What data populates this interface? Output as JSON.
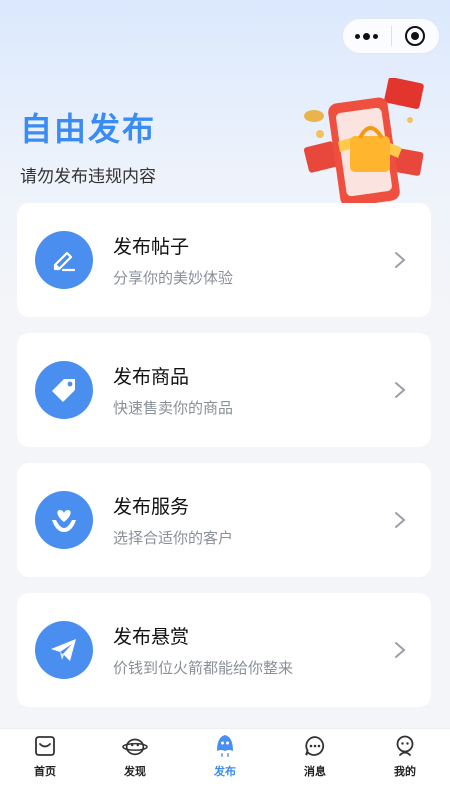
{
  "hero": {
    "title": "自由发布",
    "subtitle": "请勿发布违规内容"
  },
  "cards": [
    {
      "title": "发布帖子",
      "desc": "分享你的美妙体验",
      "icon": "pencil-icon"
    },
    {
      "title": "发布商品",
      "desc": "快速售卖你的商品",
      "icon": "tag-icon"
    },
    {
      "title": "发布服务",
      "desc": "选择合适你的客户",
      "icon": "heart-hand-icon"
    },
    {
      "title": "发布悬赏",
      "desc": "价钱到位火箭都能给你整来",
      "icon": "paper-plane-icon"
    }
  ],
  "tabs": [
    {
      "label": "首页",
      "icon": "home-icon"
    },
    {
      "label": "发现",
      "icon": "discover-icon"
    },
    {
      "label": "发布",
      "icon": "publish-icon",
      "active": true
    },
    {
      "label": "消息",
      "icon": "message-icon"
    },
    {
      "label": "我的",
      "icon": "profile-icon"
    }
  ],
  "colors": {
    "accent": "#3b8cf2",
    "icon_bg": "#4a8ff0",
    "background": "#f4f5f8"
  }
}
